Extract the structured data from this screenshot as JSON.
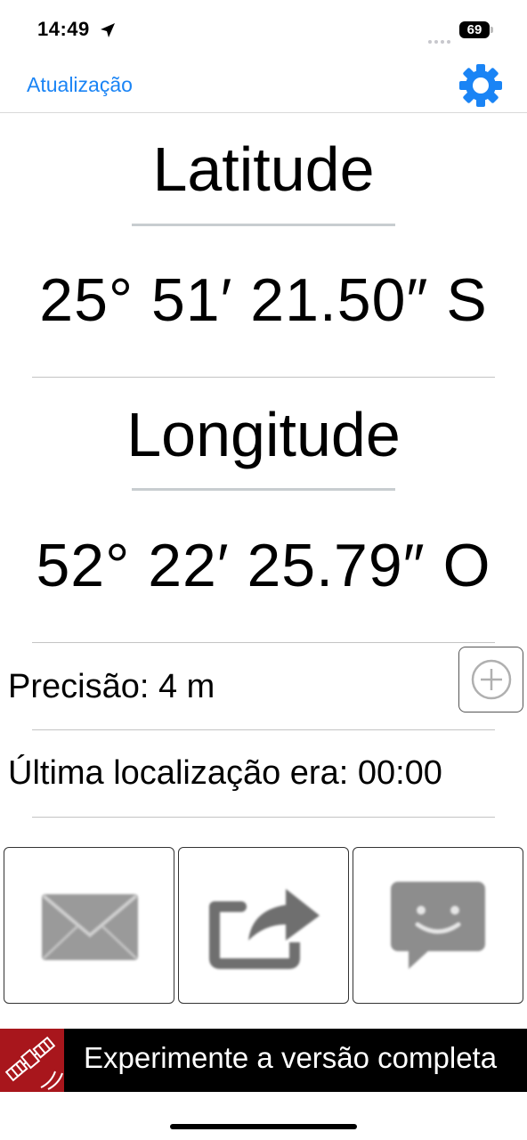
{
  "status_bar": {
    "time": "14:49",
    "battery": "69",
    "icons": [
      "location-arrow-icon",
      "signal-dots-icon",
      "battery-icon"
    ]
  },
  "nav": {
    "update_label": "Atualização",
    "settings_icon": "gear-icon",
    "accent_color": "#1a84f5"
  },
  "latitude": {
    "label": "Latitude",
    "value": "25° 51′ 21.50″ S"
  },
  "longitude": {
    "label": "Longitude",
    "value": "52° 22′ 25.79″ O"
  },
  "info": {
    "precision": "Precisão: 4 m",
    "last_location": "Última localização era: 00:00",
    "add_icon": "plus-circle-icon"
  },
  "share_buttons": [
    {
      "icon": "mail-icon"
    },
    {
      "icon": "share-icon"
    },
    {
      "icon": "message-icon"
    }
  ],
  "promo": {
    "text": "Experimente a versão completa",
    "icon": "satellite-icon",
    "icon_color": "#a8161c"
  }
}
